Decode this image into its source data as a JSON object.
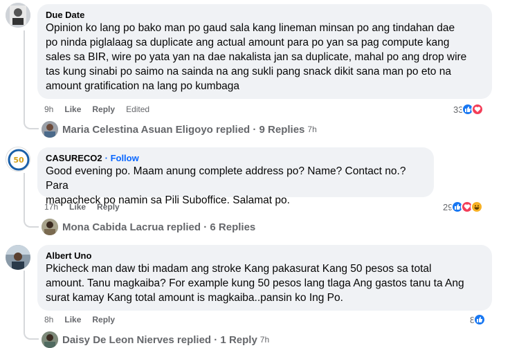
{
  "comments": [
    {
      "author": "Due Date",
      "follow": "",
      "text_lines": [
        "Opinion ko lang po bako man po gaud sala kang lineman minsan po ang tindahan dae",
        "po ninda piglalaag sa duplicate ang actual amount para po yan sa pag compute kang",
        "sales sa BIR, wire po yata yan na dae nakalista jan sa duplicate, mahal po ang drop wire",
        "tas kung sinabi po saimo na sainda na ang sukli pang snack dikit sana man po eto na",
        "amount gratification na lang po kumbaga"
      ],
      "time": "9h",
      "like_label": "Like",
      "reply_label": "Reply",
      "edited_label": "Edited",
      "reaction_count": "33",
      "reactions": [
        "like-icon",
        "heart-icon"
      ],
      "replies": {
        "name": "Maria Celestina Asuan Eligoyo",
        "text": " replied · 9 Replies",
        "time": "7h"
      }
    },
    {
      "author": "CASURECO2",
      "follow": "· Follow",
      "text_lines": [
        "Good evening po. Maam anung complete address po? Name? Contact no.? Para",
        "mapacheck po namin sa Pili Suboffice. Salamat po."
      ],
      "time": "17h",
      "like_label": "Like",
      "reply_label": "Reply",
      "edited_label": "",
      "reaction_count": "29",
      "reactions": [
        "like-icon",
        "heart-icon",
        "haha-icon"
      ],
      "replies": {
        "name": "Mona Cabida Lacrua",
        "text": " replied · 6 Replies",
        "time": ""
      }
    },
    {
      "author": "Albert Uno",
      "follow": "",
      "text_lines": [
        "Pkicheck man daw tbi madam ang stroke Kang pakasurat Kang 50 pesos sa total",
        "amount. Tanu magkaiba? For example kung 50 pesos lang tlaga Ang gastos tanu ta Ang",
        "surat kamay Kang total amount is magkaiba..pansin ko Ing Po."
      ],
      "time": "8h",
      "like_label": "Like",
      "reply_label": "Reply",
      "edited_label": "",
      "reaction_count": "8",
      "reactions": [
        "like-icon"
      ],
      "replies": {
        "name": "Daisy De Leon Nierves",
        "text": " replied · 1 Reply",
        "time": "7h"
      }
    }
  ],
  "colors": {
    "bubble": "#f0f2f5",
    "secondary_text": "#65676b",
    "follow": "#0866ff",
    "like": "#1877f2",
    "heart": "#f33e58",
    "haha": "#f7b125"
  }
}
